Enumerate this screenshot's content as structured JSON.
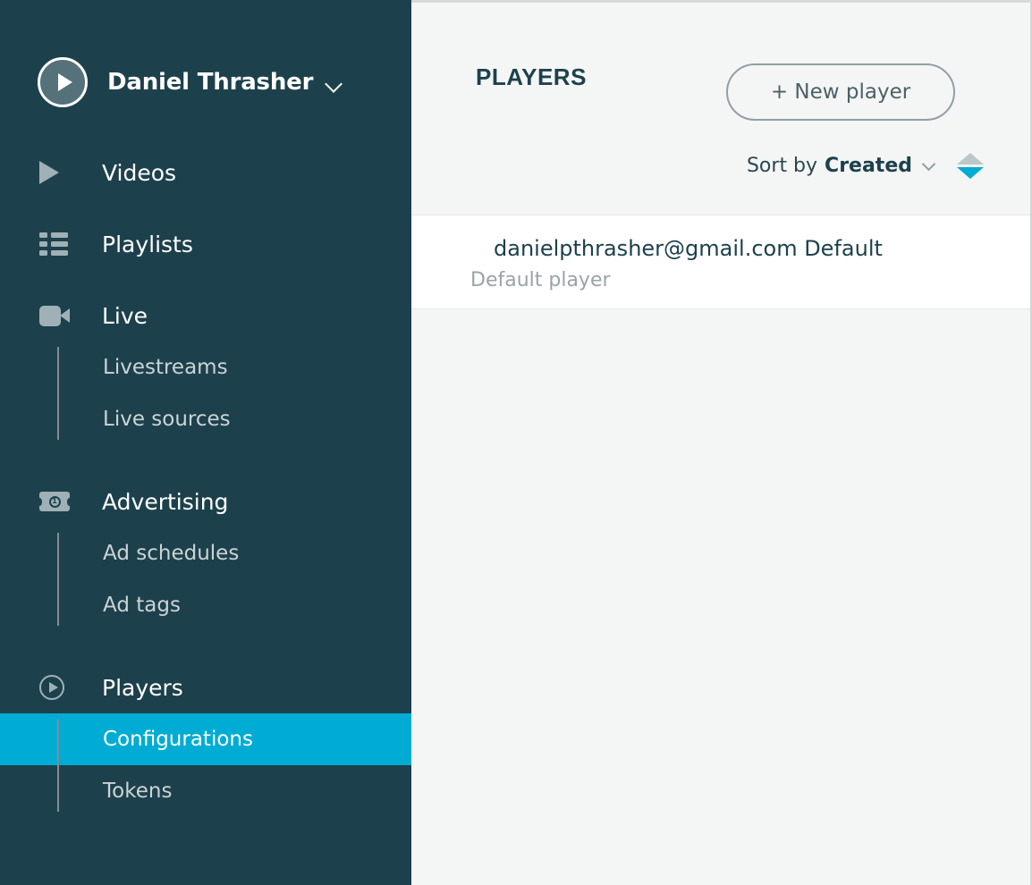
{
  "sidebar": {
    "account": {
      "name": "Daniel Thrasher",
      "avatar_icon": "play-circle-avatar",
      "caret_icon": "chevron-down-icon"
    },
    "nav": [
      {
        "label": "Videos",
        "icon": "play-triangle-icon",
        "subitems": []
      },
      {
        "label": "Playlists",
        "icon": "list-icon",
        "subitems": []
      },
      {
        "label": "Live",
        "icon": "video-camera-icon",
        "subitems": [
          {
            "label": "Livestreams",
            "active": false
          },
          {
            "label": "Live sources",
            "active": false
          }
        ]
      },
      {
        "label": "Advertising",
        "icon": "banknote-icon",
        "subitems": [
          {
            "label": "Ad schedules",
            "active": false
          },
          {
            "label": "Ad tags",
            "active": false
          }
        ]
      },
      {
        "label": "Players",
        "icon": "play-circle-outline-icon",
        "subitems": [
          {
            "label": "Configurations",
            "active": true
          },
          {
            "label": "Tokens",
            "active": false
          }
        ]
      }
    ]
  },
  "main": {
    "title": "PLAYERS",
    "new_button": "+ New player",
    "sort": {
      "label": "Sort by",
      "value": "Created",
      "caret_icon": "chevron-down-icon",
      "direction": "descending",
      "asc_icon": "triangle-up-icon",
      "desc_icon": "triangle-down-icon"
    },
    "players": [
      {
        "title": "danielpthrasher@gmail.com Default",
        "subtitle": "Default player"
      }
    ]
  },
  "colors": {
    "sidebar_bg": "#1d414c",
    "accent": "#00acd3",
    "panel_bg": "#f4f5f5",
    "row_bg": "#ffffff",
    "icon_gray": "#9fb1b6",
    "muted_text": "#9aa3a6"
  }
}
